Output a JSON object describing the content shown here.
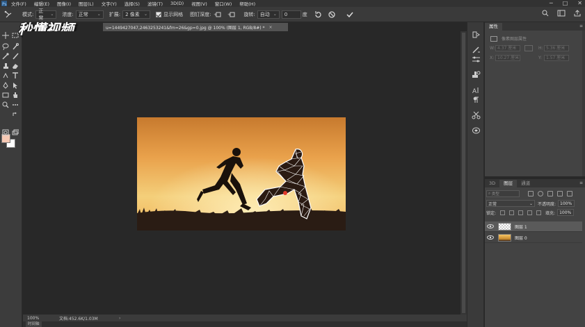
{
  "menubar": {
    "items": [
      "文件(F)",
      "编辑(E)",
      "图像(I)",
      "图层(L)",
      "文字(Y)",
      "选择(S)",
      "滤镜(T)",
      "3D(D)",
      "视图(V)",
      "窗口(W)",
      "帮助(H)"
    ]
  },
  "window_controls": {
    "minimize": "─",
    "maximize": "□",
    "close": "✕"
  },
  "options": {
    "mode_label": "模式:",
    "mode_value": "正常",
    "opacity_label": "浓度:",
    "opacity_value": "正常",
    "expand_label": "扩展:",
    "expand_value": "2 像素",
    "show_mesh_label": "显示网格",
    "pin_depth_label": "图钉深度:",
    "rotate_label": "旋转:",
    "rotate_value": "自动",
    "rotate_degrees": "0",
    "degree_unit": "度"
  },
  "watermark": "秒懂视频",
  "document": {
    "tab_title": "u=1449427047,2463253241&fm=26&gp=0.jpg @ 100% (图层 1, RGB/8#) *",
    "tab_close": "×",
    "colors": {
      "sky_top": "#e9a14b",
      "sky_mid": "#f4cf7a",
      "ground": "#2a1c14"
    }
  },
  "status": {
    "zoom": "100%",
    "doc_info": "文档:452.6K/1.03M",
    "chevron": "›",
    "timeline_tab": "时间轴"
  },
  "properties": {
    "tab_label": "属性",
    "panel_title": "像素图层属性",
    "w_label": "W:",
    "w_value": "4.37 厘米",
    "h_label": "H:",
    "h_value": "5.36 厘米",
    "x_label": "X:",
    "x_value": "10.27 厘米",
    "y_label": "Y:",
    "y_value": "1.57 厘米"
  },
  "layers": {
    "tabs": [
      "3D",
      "图层",
      "通道"
    ],
    "active_tab": 1,
    "search_placeholder": "类型",
    "blend_mode": "正常",
    "opacity_label": "不透明度:",
    "opacity_value": "100%",
    "lock_label": "锁定:",
    "fill_label": "填充:",
    "fill_value": "100%",
    "items": [
      {
        "name": "图层 1",
        "selected": true
      },
      {
        "name": "图层 0",
        "selected": false
      }
    ]
  }
}
